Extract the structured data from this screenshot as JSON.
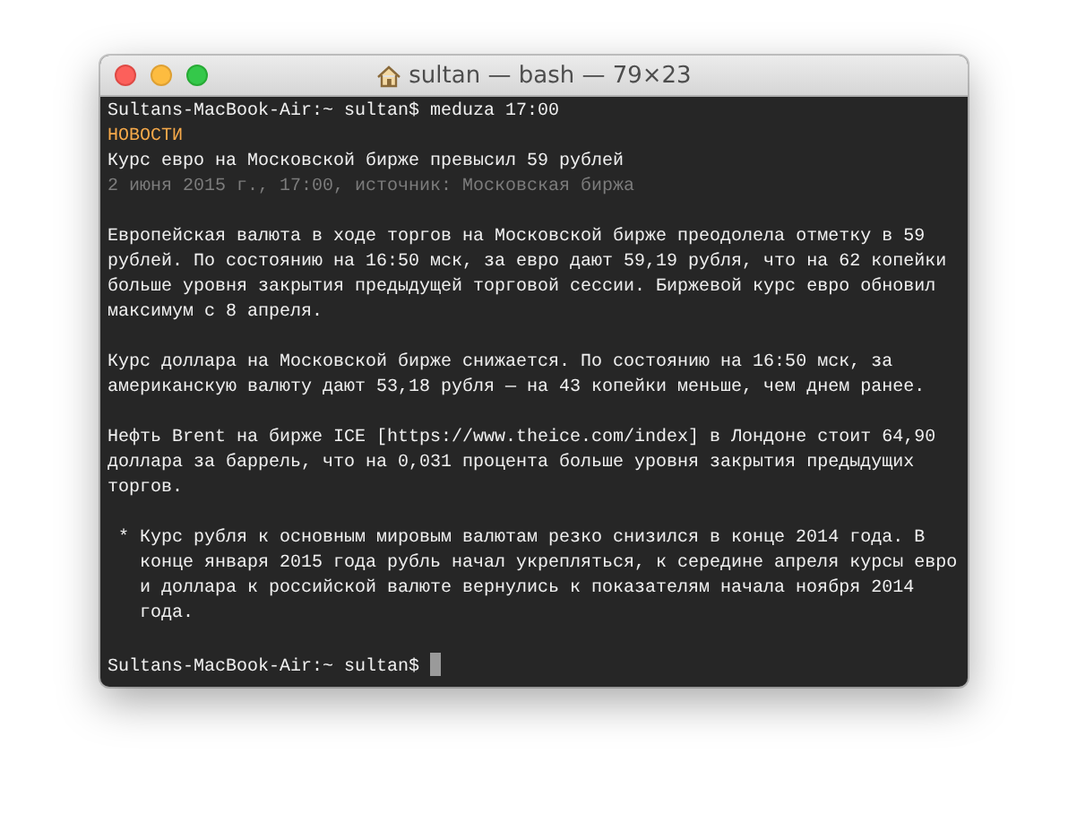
{
  "window": {
    "title": "sultan — bash — 79×23"
  },
  "terminal": [
    {
      "kind": "prompt",
      "prompt": "Sultans-MacBook-Air:~ sultan$",
      "command": "meduza 17:00",
      "cursor": false
    },
    {
      "kind": "heading",
      "lines": [
        "НОВОСТИ"
      ]
    },
    {
      "kind": "text",
      "lines": [
        "Курс евро на Московской бирже превысил 59 рублей"
      ]
    },
    {
      "kind": "meta",
      "lines": [
        "2 июня 2015 г., 17:00, источник: Московская биржа"
      ]
    },
    {
      "kind": "blank"
    },
    {
      "kind": "text",
      "lines": [
        "Европейская валюта в ходе торгов на Московской бирже преодолела отметку в 59",
        "рублей. По состоянию на 16:50 мск, за евро дают 59,19 рубля, что на 62 копейки",
        "больше уровня закрытия предыдущей торговой сессии. Биржевой курс евро обновил",
        "максимум с 8 апреля."
      ]
    },
    {
      "kind": "blank"
    },
    {
      "kind": "text",
      "lines": [
        "Курс доллара на Московской бирже снижается. По состоянию на 16:50 мск, за",
        "американскую валюту дают 53,18 рубля — на 43 копейки меньше, чем днем ранее."
      ]
    },
    {
      "kind": "blank"
    },
    {
      "kind": "text",
      "lines": [
        "Нефть Brent на бирже ICE [https://www.theice.com/index] в Лондоне стоит 64,90",
        "доллара за баррель, что на 0,031 процента больше уровня закрытия предыдущих",
        "торгов."
      ]
    },
    {
      "kind": "blank"
    },
    {
      "kind": "bullet",
      "marker": "*",
      "lines": [
        "Курс рубля к основным мировым валютам резко снизился в конце 2014 года. В",
        "конце января 2015 года рубль начал укрепляться, к середине апреля курсы евро",
        "и доллара к российской валюте вернулись к показателям начала ноября 2014",
        "года."
      ]
    },
    {
      "kind": "blank"
    },
    {
      "kind": "prompt",
      "prompt": "Sultans-MacBook-Air:~ sultan$",
      "cursor": true
    }
  ]
}
